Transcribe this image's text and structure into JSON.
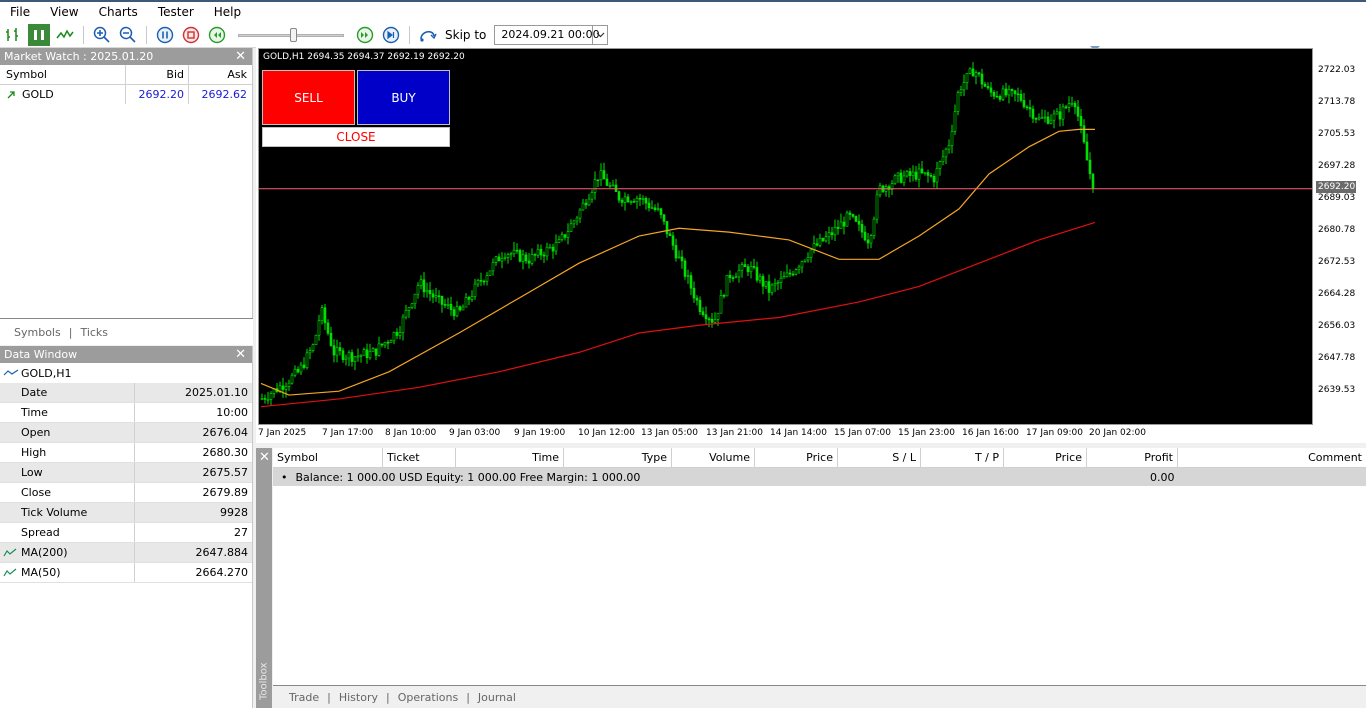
{
  "menu": [
    "File",
    "View",
    "Charts",
    "Tester",
    "Help"
  ],
  "toolbar": {
    "skip_label": "Skip to",
    "skip_value": "2024.09.21 00:00"
  },
  "market_watch": {
    "title": "Market Watch : 2025.01.20",
    "headers": {
      "symbol": "Symbol",
      "bid": "Bid",
      "ask": "Ask"
    },
    "rows": [
      {
        "symbol": "GOLD",
        "bid": "2692.20",
        "ask": "2692.62"
      }
    ],
    "tabs": [
      "Symbols",
      "Ticks"
    ]
  },
  "data_window": {
    "title": "Data Window",
    "symbol": "GOLD,H1",
    "rows": [
      {
        "k": "Date",
        "v": "2025.01.10"
      },
      {
        "k": "Time",
        "v": "10:00"
      },
      {
        "k": "Open",
        "v": "2676.04"
      },
      {
        "k": "High",
        "v": "2680.30"
      },
      {
        "k": "Low",
        "v": "2675.57"
      },
      {
        "k": "Close",
        "v": "2679.89"
      },
      {
        "k": "Tick Volume",
        "v": "9928"
      },
      {
        "k": "Spread",
        "v": "27"
      },
      {
        "k": "MA(200)",
        "v": "2647.884"
      },
      {
        "k": "MA(50)",
        "v": "2664.270"
      }
    ]
  },
  "chart": {
    "header": "GOLD,H1  2694.35 2694.37 2692.19 2692.20",
    "sell_label": "SELL",
    "buy_label": "BUY",
    "close_label": "CLOSE",
    "price_labels": [
      "2722.03",
      "2713.78",
      "2705.53",
      "2697.28",
      "2689.03",
      "2680.78",
      "2672.53",
      "2664.28",
      "2656.03",
      "2647.78",
      "2639.53"
    ],
    "current_price": "2692.20",
    "time_labels": [
      "7 Jan 2025",
      "7 Jan 17:00",
      "8 Jan 10:00",
      "9 Jan 03:00",
      "9 Jan 19:00",
      "10 Jan 12:00",
      "13 Jan 05:00",
      "13 Jan 21:00",
      "14 Jan 14:00",
      "15 Jan 07:00",
      "15 Jan 23:00",
      "16 Jan 16:00",
      "17 Jan 09:00",
      "20 Jan 02:00"
    ],
    "candle_color": "#00e000",
    "ma50_color": "#f5a623",
    "ma200_color": "#e01010",
    "price_line_color": "#ff6070"
  },
  "trade": {
    "headers": [
      "Symbol",
      "Ticket",
      "Time",
      "Type",
      "Volume",
      "Price",
      "S / L",
      "T / P",
      "Price",
      "Profit",
      "Comment"
    ],
    "balance_text": "Balance: 1 000.00 USD  Equity: 1 000.00  Free Margin: 1 000.00",
    "profit": "0.00",
    "toolbox_label": "Toolbox",
    "tabs": [
      "Trade",
      "History",
      "Operations",
      "Journal"
    ]
  }
}
